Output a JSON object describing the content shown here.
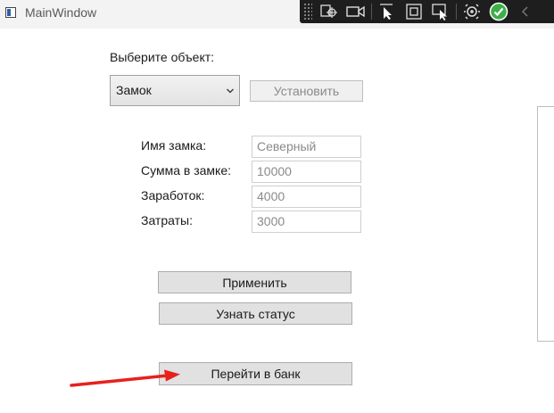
{
  "window": {
    "title": "MainWindow"
  },
  "debug_toolbar": {
    "icons": [
      "live-visual-tree-icon",
      "record-icon",
      "select-element-icon",
      "display-adorners-icon",
      "track-focus-icon",
      "hot-reload-icon",
      "binding-failures-ok-icon",
      "collapse-toolbar-icon"
    ]
  },
  "form": {
    "select_label": "Выберите объект:",
    "combo_value": "Замок",
    "set_button": "Установить",
    "fields": [
      {
        "label": "Имя замка:",
        "value": "Северный"
      },
      {
        "label": "Сумма в замке:",
        "value": "10000"
      },
      {
        "label": "Заработок:",
        "value": "4000"
      },
      {
        "label": "Затраты:",
        "value": "3000"
      }
    ],
    "apply_button": "Применить",
    "status_button": "Узнать статус",
    "bank_button": "Перейти в банк"
  },
  "colors": {
    "annotation_arrow": "#e8201c",
    "debug_toolbar_bg": "#1e1e1e",
    "ok_badge": "#3fae49"
  }
}
